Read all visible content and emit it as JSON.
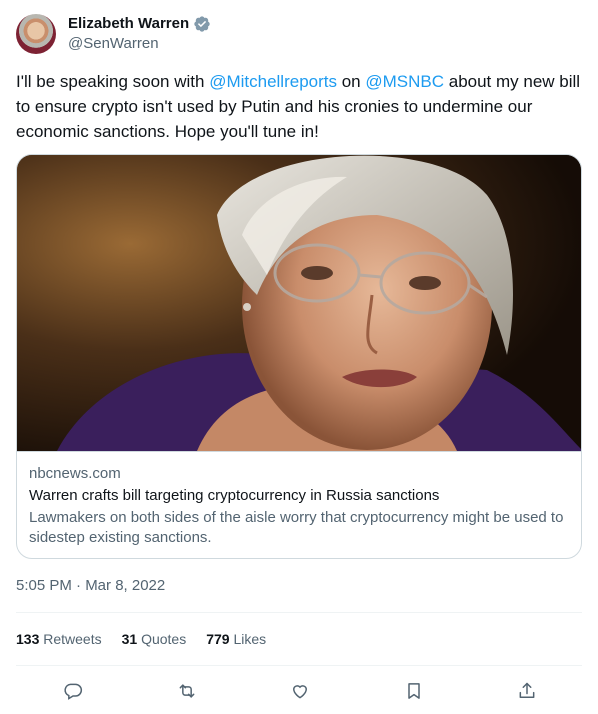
{
  "author": {
    "display_name": "Elizabeth Warren",
    "handle": "@SenWarren",
    "verified_icon": "verified-badge-icon",
    "verified_color": "#829aab"
  },
  "tweet": {
    "text_parts": [
      "I'll be speaking soon with ",
      "@Mitchellreports",
      " on ",
      "@MSNBC",
      " about my new bill to ensure crypto isn't used by Putin and his cronies to undermine our economic sanctions. Hope you'll tune in!"
    ],
    "mention_color": "#1d9bf0",
    "timestamp": "5:05 PM · Mar 8, 2022"
  },
  "card": {
    "domain": "nbcnews.com",
    "title": "Warren crafts bill targeting cryptocurrency in Russia sanctions",
    "description": "Lawmakers on both sides of the aisle worry that cryptocurrency might be used to sidestep existing sanctions."
  },
  "stats": {
    "retweets_count": "133",
    "retweets_label": "Retweets",
    "quotes_count": "31",
    "quotes_label": "Quotes",
    "likes_count": "779",
    "likes_label": "Likes"
  },
  "actions": [
    "reply-icon",
    "retweet-icon",
    "like-icon",
    "bookmark-icon",
    "share-icon"
  ],
  "colors": {
    "text_primary": "#0f1419",
    "text_secondary": "#536471",
    "border": "#cfd9de",
    "divider": "#eff3f4"
  }
}
